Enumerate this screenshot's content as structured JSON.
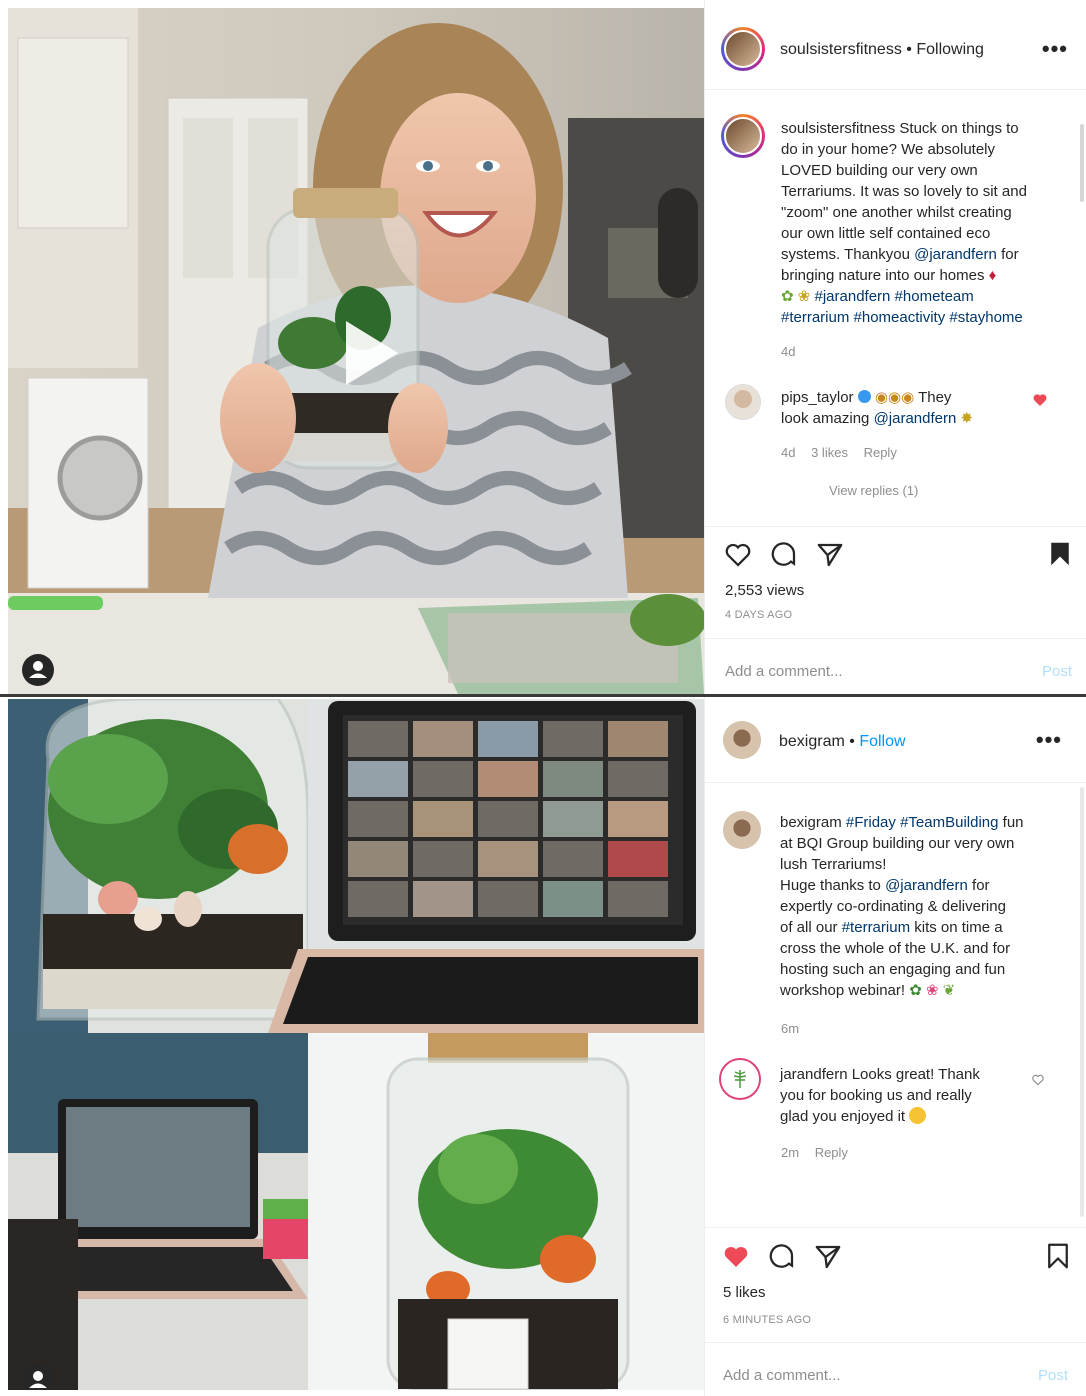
{
  "post1": {
    "username": "soulsistersfitness",
    "separator": "•",
    "follow_state": "Following",
    "more": "•••",
    "caption_user": "soulsistersfitness",
    "caption_lines": [
      "Stuck on things to",
      "do in your home? We absolutely",
      "LOVED building our very own",
      "Terrariums. It was so lovely to sit and",
      "\"zoom\" one another whilst creating",
      "our own little self contained eco",
      "systems. Thankyou",
      "bringing nature into our homes"
    ],
    "mention_jarandfern": "@jarandfern",
    "for_word": "for",
    "hashtags_line1": "#jarandfern #hometeam",
    "hashtags_line2": "#terrarium #homeactivity #stayhome",
    "caption_time": "4d",
    "comment": {
      "username": "pips_taylor",
      "text_after": "They",
      "text_line2": "look amazing",
      "mention": "@jarandfern",
      "time": "4d",
      "likes": "3 likes",
      "reply": "Reply",
      "view_replies": "View replies (1)"
    },
    "views": "2,553 views",
    "ago": "4 DAYS AGO",
    "add_comment_placeholder": "Add a comment...",
    "post_label": "Post"
  },
  "post2": {
    "username": "bexigram",
    "separator": "•",
    "follow_state": "Follow",
    "more": "•••",
    "caption_user": "bexigram",
    "tag_friday": "#Friday",
    "tag_teambuilding": "#TeamBuilding",
    "line1_end": "fun",
    "lines": [
      "at BQI Group building our very own",
      "lush Terrariums!",
      "Huge thanks to",
      "expertly co-ordinating & delivering",
      "of all our",
      "cross the whole of the U.K. and for",
      "hosting such an engaging and fun",
      "workshop webinar!"
    ],
    "mention_jarandfern": "@jarandfern",
    "for_word": "for",
    "tag_terrarium": "#terrarium",
    "kits_text": "kits on time a",
    "caption_time": "6m",
    "comment": {
      "username": "jarandfern",
      "text_line1": "Looks great! Thank",
      "text_line2": "you for booking us and really",
      "text_line3": "glad you enjoyed it",
      "time": "2m",
      "reply": "Reply"
    },
    "likes": "5 likes",
    "ago": "6 MINUTES AGO",
    "add_comment_placeholder": "Add a comment...",
    "post_label": "Post"
  },
  "colors": {
    "link": "#00376b",
    "follow_blue": "#0095f6",
    "like_red": "#ed4956",
    "muted": "#8e8e8e"
  },
  "icons": [
    "heart-icon",
    "comment-icon",
    "share-icon",
    "bookmark-icon",
    "play-icon",
    "user-tag-icon",
    "verified-icon"
  ]
}
